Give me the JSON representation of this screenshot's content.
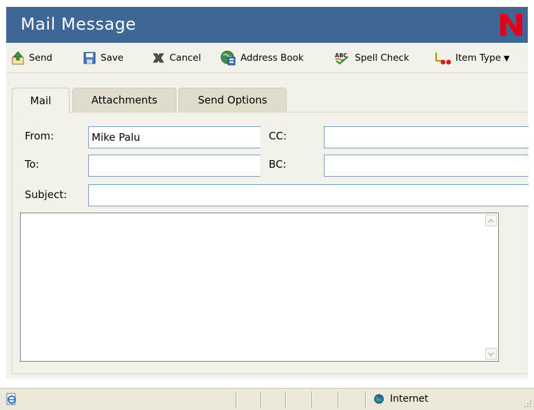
{
  "window": {
    "title": "Mail Message",
    "brand_color": "#3f6796",
    "logo_color": "#e2001a"
  },
  "toolbar": {
    "items": [
      {
        "label": "Send",
        "icon": "send-icon"
      },
      {
        "label": "Save",
        "icon": "save-icon"
      },
      {
        "label": "Cancel",
        "icon": "cancel-icon"
      },
      {
        "label": "Address Book",
        "icon": "address-book-icon"
      },
      {
        "label": "Spell Check",
        "icon": "spell-check-icon"
      },
      {
        "label": "Item Type",
        "icon": "item-type-icon",
        "has_dropdown": true
      }
    ]
  },
  "tabs": [
    {
      "label": "Mail",
      "active": true
    },
    {
      "label": "Attachments",
      "active": false
    },
    {
      "label": "Send Options",
      "active": false
    }
  ],
  "form": {
    "from_label": "From:",
    "from_value": "Mike Palu",
    "cc_label": "CC:",
    "cc_value": "",
    "to_label": "To:",
    "to_value": "",
    "bc_label": "BC:",
    "bc_value": "",
    "subject_label": "Subject:",
    "subject_value": "",
    "body_value": ""
  },
  "statusbar": {
    "zone_label": "Internet",
    "zone_icon": "globe-icon",
    "page_icon": "ie-page-icon"
  }
}
